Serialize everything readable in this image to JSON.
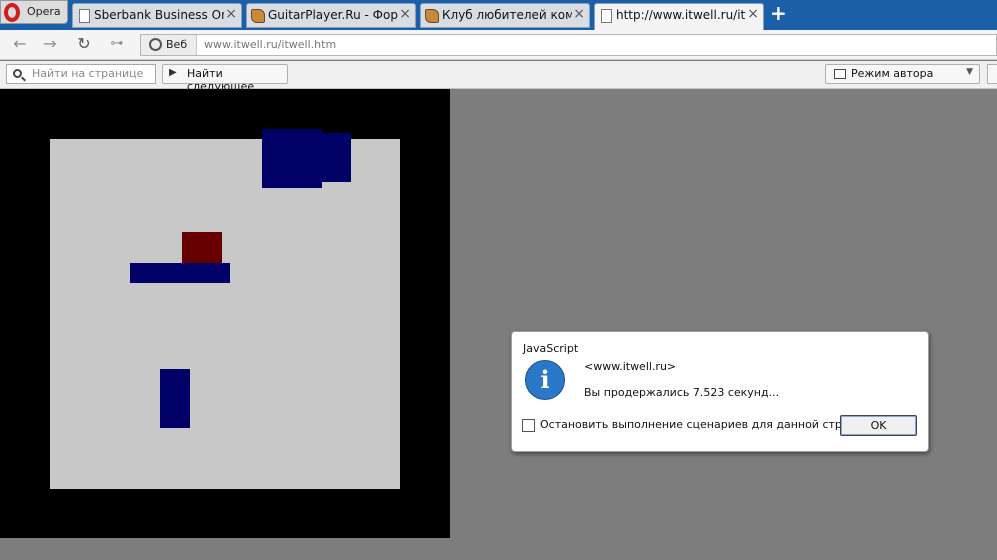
{
  "browser": {
    "menu_label": "Opera",
    "tabs": [
      {
        "label": "Sberbank Business Online",
        "active": false
      },
      {
        "label": "GuitarPlayer.Ru - Форум",
        "active": false
      },
      {
        "label": "Клуб любителей компьютерных",
        "active": false
      },
      {
        "label": "http://www.itwell.ru/itwell.htm",
        "active": true
      }
    ],
    "new_tab": "+",
    "close_glyph": "×"
  },
  "address": {
    "badge": "Веб",
    "url": "www.itwell.ru/itwell.htm"
  },
  "findbar": {
    "placeholder": "Найти на странице",
    "next_label": "Найти следующее",
    "author_mode": "Режим автора"
  },
  "dialog": {
    "title": "JavaScript",
    "host": "<www.itwell.ru>",
    "message": "Вы продержались 7.523 секунд...",
    "checkbox_label": "Остановить выполнение сценариев для данной страницы",
    "ok_label": "OK"
  },
  "colors": {
    "tab_bar": "#1a5fa8",
    "game_border": "#000000",
    "game_field": "#c8c8c8",
    "enemy_blocks": "#000066",
    "player_block": "#660000",
    "page_background": "#7d7d7d"
  }
}
